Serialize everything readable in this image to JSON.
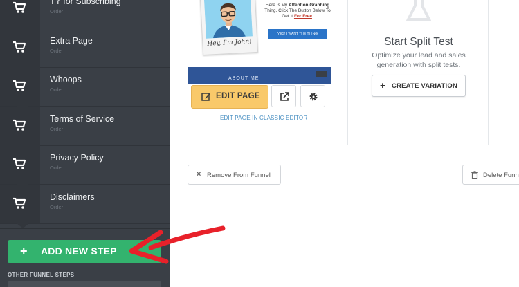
{
  "sidebar": {
    "steps": [
      {
        "title": "TY for Subscribing",
        "sub": "Order"
      },
      {
        "title": "Extra Page",
        "sub": "Order"
      },
      {
        "title": "Whoops",
        "sub": "Order"
      },
      {
        "title": "Terms of Service",
        "sub": "Order"
      },
      {
        "title": "Privacy Policy",
        "sub": "Order"
      },
      {
        "title": "Disclaimers",
        "sub": "Order"
      }
    ],
    "add_step_label": "ADD NEW STEP",
    "add_step_plus": "+",
    "other_steps_label": "OTHER FUNNEL STEPS"
  },
  "preview": {
    "polaroid_caption": "Hey, I'm John!",
    "attn_line1": "Here Is My",
    "attn_bold": "Attention Grabbing",
    "attn_line2": "Thing. Click The Button Below To Get It",
    "attn_free": "For Free",
    "attn_button": "YES! I WANT THE THING",
    "banner_text": "ABOUT ME"
  },
  "page_actions": {
    "edit_label": "EDIT PAGE",
    "classic_link": "EDIT PAGE IN CLASSIC EDITOR"
  },
  "split_test": {
    "title": "Start Split Test",
    "description": "Optimize your lead and sales generation with split tests.",
    "create_label": "CREATE VARIATION",
    "create_plus": "+"
  },
  "footer_actions": {
    "remove_label": "Remove From Funnel",
    "remove_x": "×",
    "delete_label": "Delete Funnel Step"
  },
  "colors": {
    "sidebar_bg": "#3a3f46",
    "add_step_green": "#33b36e",
    "edit_yellow": "#f9c96a",
    "link_blue": "#4a90c2",
    "arrow_red": "#e8212a"
  }
}
